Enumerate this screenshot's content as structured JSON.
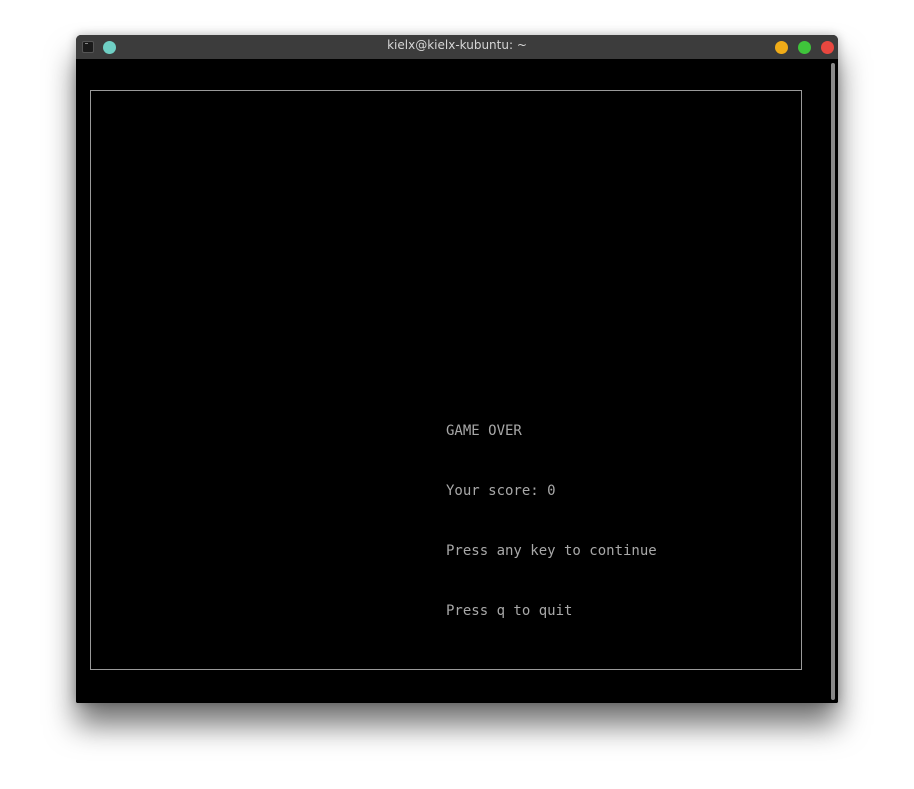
{
  "window": {
    "title": "kielx@kielx-kubuntu: ~",
    "icons": {
      "app": "terminal-icon",
      "pin": "pin-icon",
      "minimize": "minimize-icon",
      "maximize": "maximize-icon",
      "close": "close-icon"
    },
    "colors": {
      "pin": "#6fcfc4",
      "minimize": "#f0ac18",
      "maximize": "#3fc43b",
      "close": "#e8473f"
    }
  },
  "game": {
    "lines": [
      "GAME OVER",
      "Your score: 0",
      "Press any key to continue",
      "Press q to quit"
    ]
  }
}
